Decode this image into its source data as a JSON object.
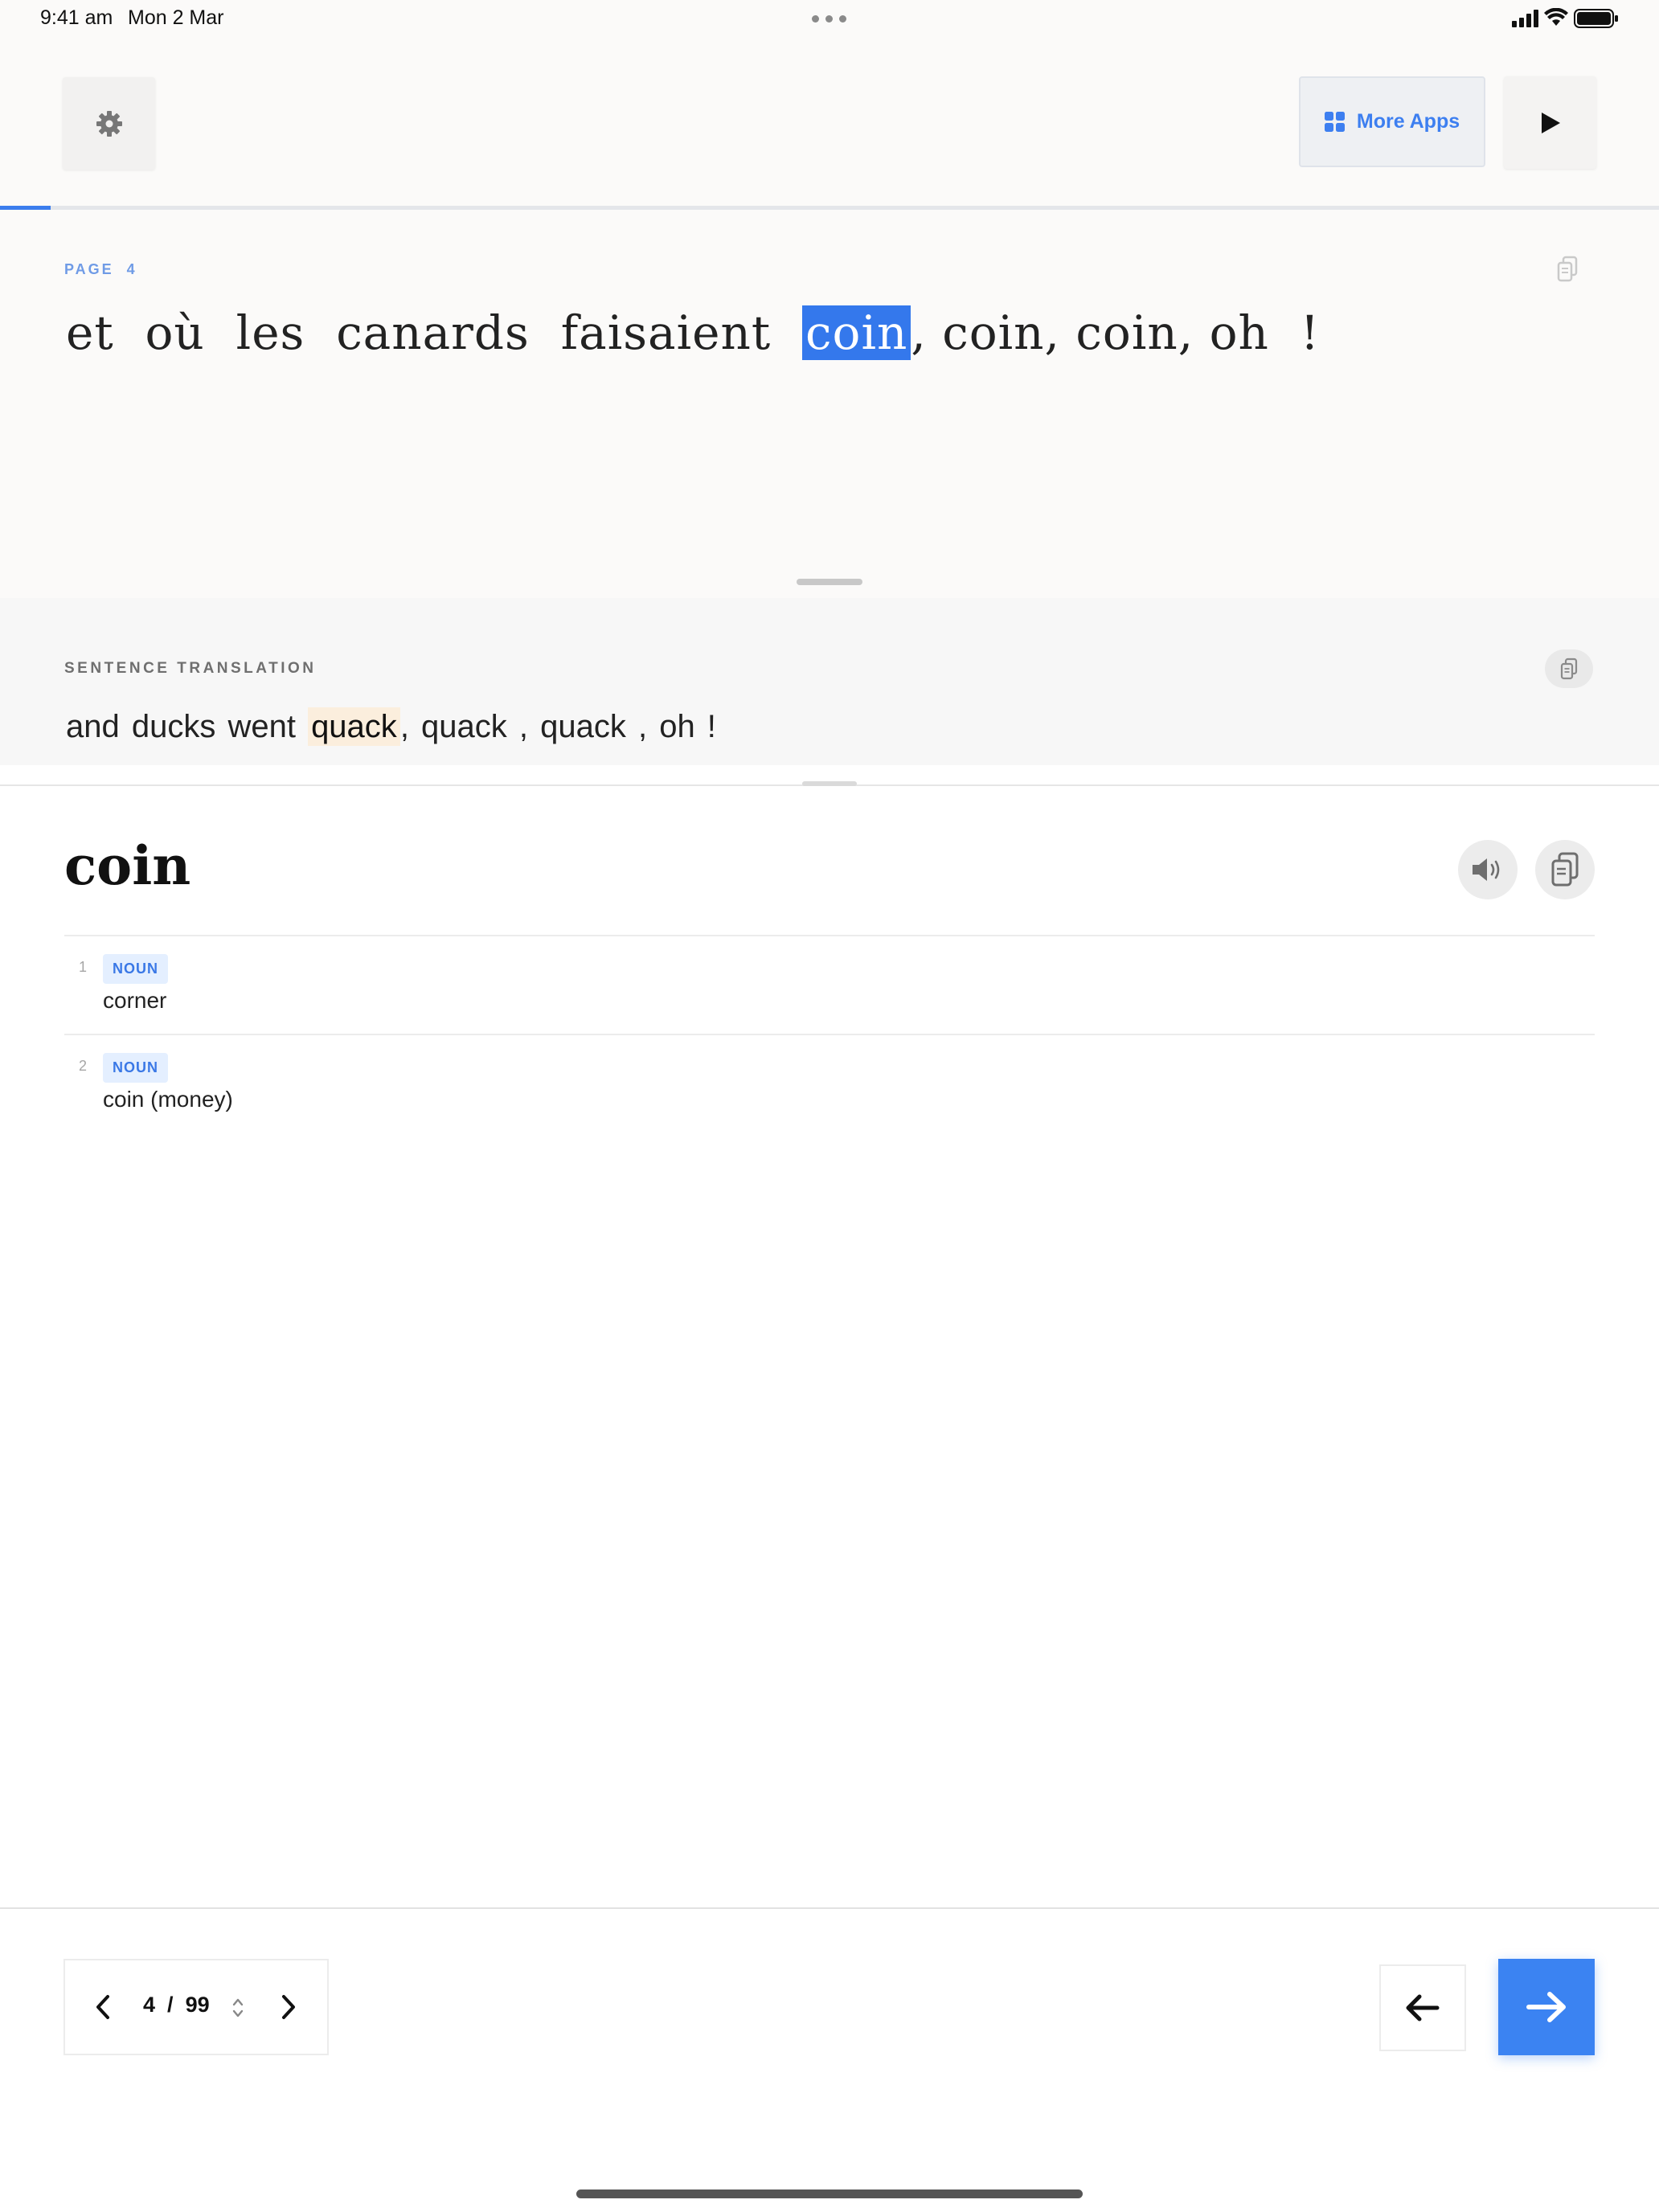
{
  "status_bar": {
    "time": "9:41 am",
    "date": "Mon 2 Mar",
    "icons": [
      "cellular-signal-icon",
      "wifi-icon",
      "battery-icon"
    ]
  },
  "header": {
    "settings_icon": "gear-icon",
    "more_apps_label": "More Apps",
    "more_apps_icon": "grid-icon",
    "play_icon": "play-icon"
  },
  "reading": {
    "page_label": "PAGE  4",
    "words": [
      "et",
      "où",
      "les",
      "canards",
      "faisaient",
      "coin",
      ", coin",
      ", coin",
      ", oh",
      "!"
    ],
    "highlighted_word": "coin",
    "copy_icon": "copy-icon"
  },
  "translation": {
    "label": "SENTENCE TRANSLATION",
    "text_before": "and ducks went ",
    "highlighted": "quack",
    "text_after": ", quack , quack , oh !"
  },
  "dictionary": {
    "word": "coin",
    "definitions": [
      {
        "num": "1",
        "pos": "NOUN",
        "text": "corner"
      },
      {
        "num": "2",
        "pos": "NOUN",
        "text": "coin (money)"
      }
    ]
  },
  "pager": {
    "current": "4",
    "separator": "/",
    "total": "99"
  },
  "colors": {
    "accent": "#3b7ded",
    "highlight_source": "#3478ec",
    "highlight_translation": "#fbeedd"
  }
}
